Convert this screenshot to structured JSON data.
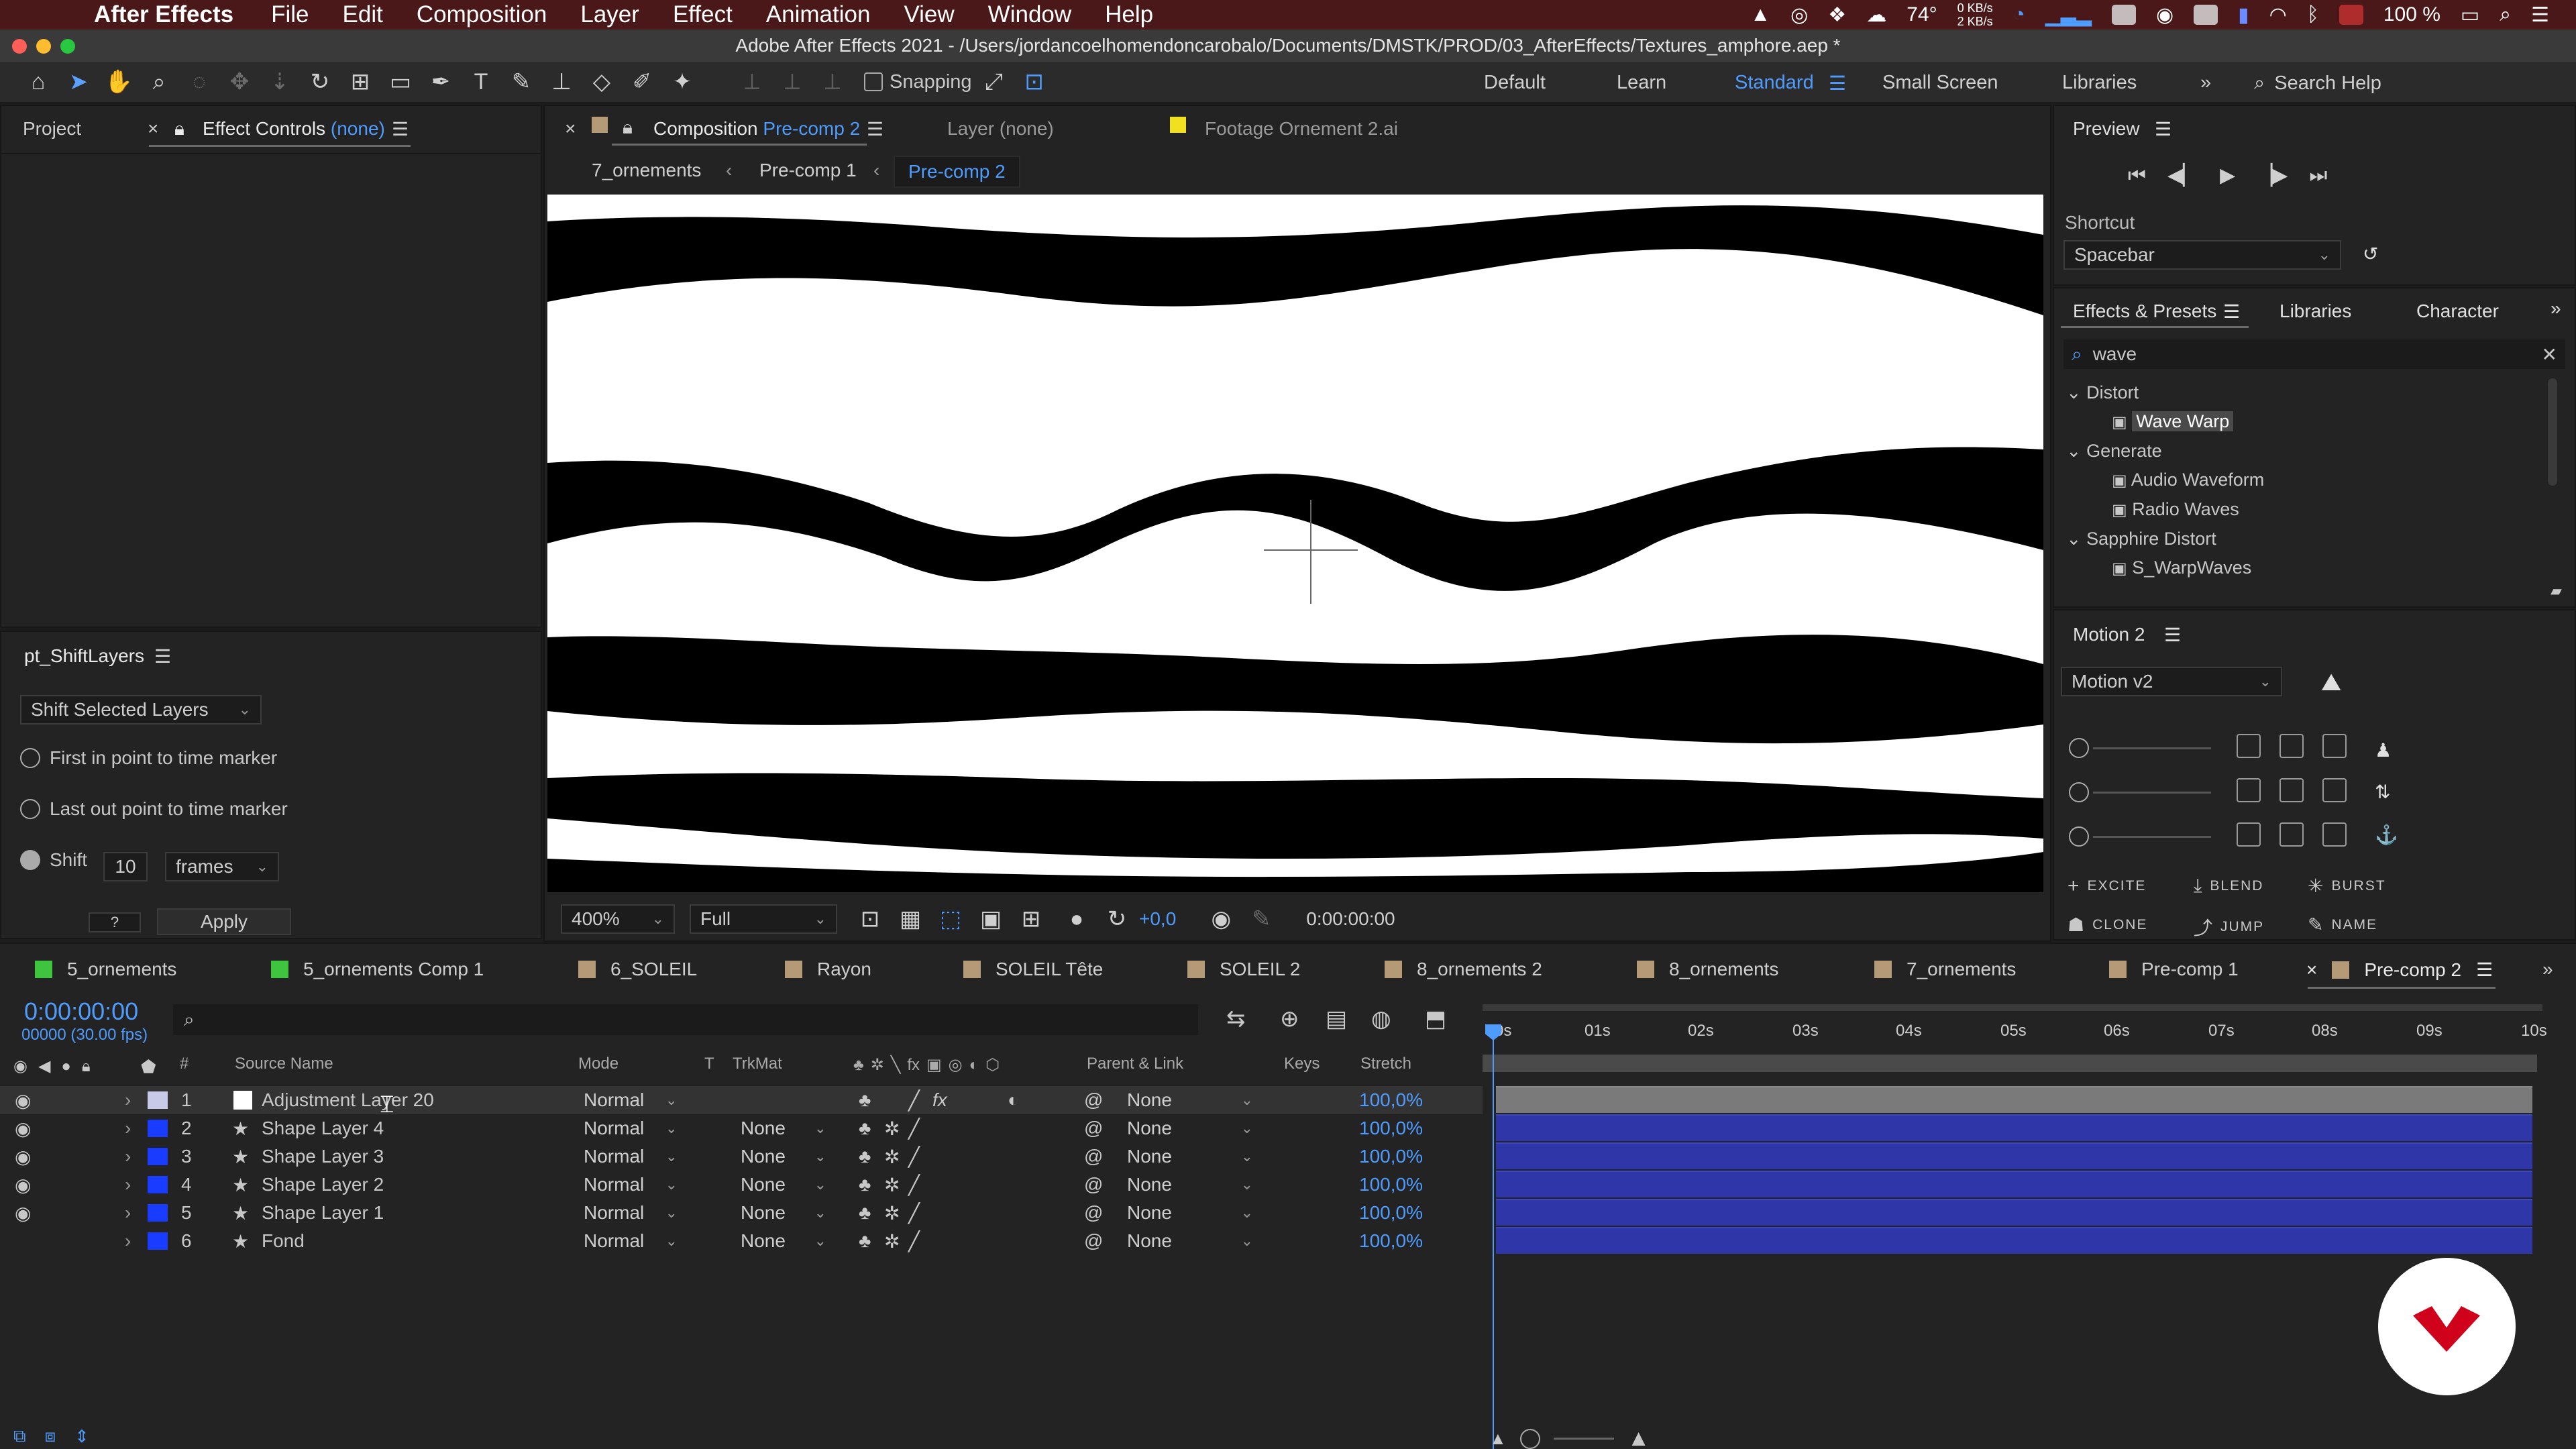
{
  "menubar": {
    "app": "After Effects",
    "menus": [
      "File",
      "Edit",
      "Composition",
      "Layer",
      "Effect",
      "Animation",
      "View",
      "Window",
      "Help"
    ],
    "temperature": "74°",
    "net_up": "0 KB/s",
    "net_down": "2 KB/s",
    "battery": "100 %"
  },
  "titlebar": {
    "title": "Adobe After Effects 2021 - /Users/jordancoelhomendoncarobalo/Documents/DMSTK/PROD/03_AfterEffects/Textures_amphore.aep *"
  },
  "toolbar": {
    "snapping": "Snapping",
    "workspaces": [
      "Default",
      "Learn",
      "Standard",
      "Small Screen",
      "Libraries"
    ],
    "active_workspace": "Standard",
    "search_placeholder": "Search Help"
  },
  "left_panel": {
    "tab_project": "Project",
    "tab_effect_controls": "Effect Controls",
    "effect_controls_target": "(none)"
  },
  "shift_layers": {
    "title": "pt_ShiftLayers",
    "mode": "Shift Selected Layers",
    "option1": "First in point to time marker",
    "option2": "Last out point to time marker",
    "shift_label": "Shift",
    "shift_value": "10",
    "unit": "frames",
    "small_field": "?",
    "apply": "Apply"
  },
  "comp_panel": {
    "tab_label": "Composition",
    "tab_comp": "Pre-comp 2",
    "tab_layer": "Layer (none)",
    "tab_footage": "Footage Ornement 2.ai",
    "breadcrumbs": [
      "7_ornements",
      "Pre-comp 1",
      "Pre-comp 2"
    ],
    "zoom": "400%",
    "resolution": "Full",
    "exposure": "+0,0",
    "timecode": "0:00:00:00"
  },
  "preview": {
    "title": "Preview",
    "shortcut_label": "Shortcut",
    "shortcut_value": "Spacebar"
  },
  "effects_presets": {
    "tabs": [
      "Effects & Presets",
      "Libraries",
      "Character"
    ],
    "search_value": "wave",
    "groups": [
      {
        "name": "Distort",
        "items": [
          "Wave Warp"
        ]
      },
      {
        "name": "Generate",
        "items": [
          "Audio Waveform",
          "Radio Waves"
        ]
      },
      {
        "name": "Sapphire Distort",
        "items": [
          "S_WarpWaves"
        ]
      }
    ]
  },
  "motion": {
    "title": "Motion 2",
    "preset": "Motion v2",
    "buttons": [
      "EXCITE",
      "BLEND",
      "BURST",
      "CLONE",
      "JUMP",
      "NAME"
    ]
  },
  "timeline": {
    "tabs": [
      {
        "label": "5_ornements",
        "color": "#3fc43f"
      },
      {
        "label": "5_ornements Comp 1",
        "color": "#3fc43f"
      },
      {
        "label": "6_SOLEIL",
        "color": "#b59a78"
      },
      {
        "label": "Rayon",
        "color": "#b59a78"
      },
      {
        "label": "SOLEIL Tête",
        "color": "#b59a78"
      },
      {
        "label": "SOLEIL 2",
        "color": "#b59a78"
      },
      {
        "label": "8_ornements 2",
        "color": "#b59a78"
      },
      {
        "label": "8_ornements",
        "color": "#b59a78"
      },
      {
        "label": "7_ornements",
        "color": "#b59a78"
      },
      {
        "label": "Pre-comp 1",
        "color": "#b59a78"
      },
      {
        "label": "Pre-comp 2",
        "color": "#b59a78"
      }
    ],
    "timecode": "0:00:00:00",
    "frame_info": "00000 (30.00 fps)",
    "headers": [
      "#",
      "Source Name",
      "Mode",
      "T",
      "TrkMat",
      "Parent & Link",
      "Keys",
      "Stretch"
    ],
    "ruler": [
      "0s",
      "01s",
      "02s",
      "03s",
      "04s",
      "05s",
      "06s",
      "07s",
      "08s",
      "09s",
      "10s"
    ],
    "layers": [
      {
        "num": "1",
        "name": "Adjustment Layer 20",
        "mode": "Normal",
        "trkmat": "",
        "parent": "None",
        "stretch": "100,0%",
        "color": "#c8c8e8"
      },
      {
        "num": "2",
        "name": "Shape Layer 4",
        "mode": "Normal",
        "trkmat": "None",
        "parent": "None",
        "stretch": "100,0%",
        "color": "#1a3cff"
      },
      {
        "num": "3",
        "name": "Shape Layer 3",
        "mode": "Normal",
        "trkmat": "None",
        "parent": "None",
        "stretch": "100,0%",
        "color": "#1a3cff"
      },
      {
        "num": "4",
        "name": "Shape Layer 2",
        "mode": "Normal",
        "trkmat": "None",
        "parent": "None",
        "stretch": "100,0%",
        "color": "#1a3cff"
      },
      {
        "num": "5",
        "name": "Shape Layer 1",
        "mode": "Normal",
        "trkmat": "None",
        "parent": "None",
        "stretch": "100,0%",
        "color": "#1a3cff"
      },
      {
        "num": "6",
        "name": "Fond",
        "mode": "Normal",
        "trkmat": "None",
        "parent": "None",
        "stretch": "100,0%",
        "color": "#1a3cff"
      }
    ]
  },
  "colors": {
    "accent": "#4f9cff",
    "layer_bar": "#2f37a8",
    "menubar": "#4a1818",
    "brand_logo": "#d0021b"
  }
}
